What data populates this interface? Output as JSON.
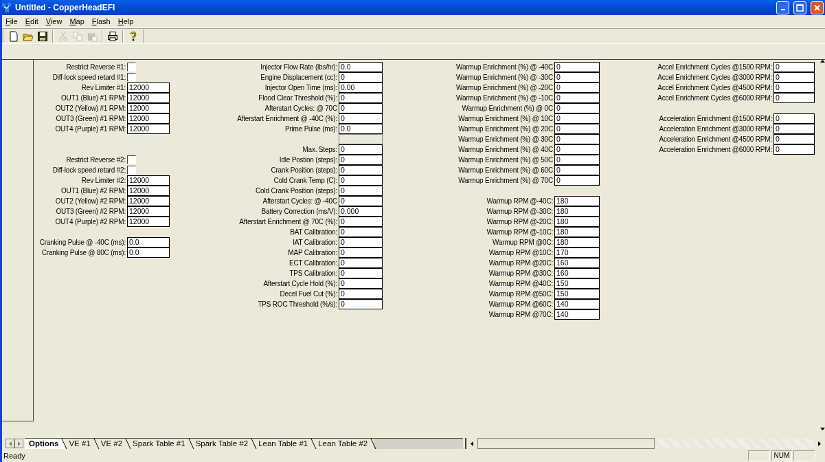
{
  "window": {
    "title": "Untitled - CopperHeadEFI"
  },
  "menu": [
    "File",
    "Edit",
    "View",
    "Map",
    "Flash",
    "Help"
  ],
  "toolbar": [
    {
      "kind": "new",
      "disabled": false
    },
    {
      "kind": "open",
      "disabled": false
    },
    {
      "kind": "save",
      "disabled": false
    },
    {
      "kind": "separator"
    },
    {
      "kind": "cut",
      "disabled": true
    },
    {
      "kind": "copy",
      "disabled": true
    },
    {
      "kind": "paste",
      "disabled": true
    },
    {
      "kind": "separator"
    },
    {
      "kind": "print",
      "disabled": false
    },
    {
      "kind": "separator"
    },
    {
      "kind": "help",
      "disabled": false
    }
  ],
  "form": {
    "columns": [
      {
        "groups": [
          {
            "rows": [
              {
                "kind": "checkbox",
                "label": "Restrict Reverse #1:",
                "checked": false
              },
              {
                "kind": "checkbox",
                "label": "Diff-lock speed retard #1:",
                "checked": false
              },
              {
                "kind": "field",
                "label": "Rev Limiter #1:",
                "value": "12000"
              },
              {
                "kind": "field",
                "label": "OUT1 (Blue) #1 RPM:",
                "value": "12000"
              },
              {
                "kind": "field",
                "label": "OUT2 (Yellow) #1 RPM:",
                "value": "12000"
              },
              {
                "kind": "field",
                "label": "OUT3 (Green) #1 RPM:",
                "value": "12000"
              },
              {
                "kind": "field",
                "label": "OUT4 (Purple) #1 RPM:",
                "value": "12000"
              }
            ]
          },
          {
            "rows": [
              {
                "kind": "checkbox",
                "label": "Restrict Reverse #2:",
                "checked": false
              },
              {
                "kind": "checkbox",
                "label": "Diff-lock speed retard #2:",
                "checked": false
              },
              {
                "kind": "field",
                "label": "Rev Limiter #2:",
                "value": "12000"
              },
              {
                "kind": "field",
                "label": "OUT1 (Blue) #2 RPM:",
                "value": "12000"
              },
              {
                "kind": "field",
                "label": "OUT2 (Yellow) #2 RPM:",
                "value": "12000"
              },
              {
                "kind": "field",
                "label": "OUT3 (Green) #2 RPM:",
                "value": "12000"
              },
              {
                "kind": "field",
                "label": "OUT4 (Purple) #2 RPM:",
                "value": "12000"
              }
            ]
          },
          {
            "rows": [
              {
                "kind": "field",
                "label": "Cranking Pulse @ -40C (ms):",
                "value": "0.0"
              },
              {
                "kind": "field",
                "label": "Cranking Pulse @ 80C (ms):",
                "value": "0.0"
              }
            ]
          }
        ]
      },
      {
        "groups": [
          {
            "rows": [
              {
                "kind": "field",
                "label": "Injector Flow Rate (lbs/hr):",
                "value": "0.0"
              },
              {
                "kind": "field",
                "label": "Engine Displacement (cc):",
                "value": "0"
              },
              {
                "kind": "field",
                "label": "Injector Open Time (ms):",
                "value": "0.00"
              },
              {
                "kind": "field",
                "label": "Flood Clear Threshold (%):",
                "value": "0"
              },
              {
                "kind": "field",
                "label": "Afterstart Cycles: @ 70C",
                "value": "0"
              },
              {
                "kind": "field",
                "label": "Afterstart Enrichment @ -40C (%):",
                "value": "0"
              },
              {
                "kind": "field",
                "label": "Prime Pulse (ms):",
                "value": "0.0"
              },
              {
                "kind": "field",
                "disabled": true
              },
              {
                "kind": "field",
                "label": "Max. Steps:",
                "value": "0"
              },
              {
                "kind": "field",
                "label": "Idle Postion (steps):",
                "value": "0"
              },
              {
                "kind": "field",
                "label": "Crank Position (steps):",
                "value": "0"
              },
              {
                "kind": "field",
                "label": "Cold Crank Temp (C):",
                "value": "0"
              },
              {
                "kind": "field",
                "label": "Cold Crank Position (steps):",
                "value": "0"
              },
              {
                "kind": "field",
                "label": "Afterstart Cycles: @ -40C",
                "value": "0"
              },
              {
                "kind": "field",
                "label": "Battery Correction (ms/V):",
                "value": "0.000"
              },
              {
                "kind": "field",
                "label": "Afterstart Enrichment @ 70C (%):",
                "value": "0"
              },
              {
                "kind": "field",
                "label": "BAT Calibration:",
                "value": "0"
              },
              {
                "kind": "field",
                "label": "IAT Calibration:",
                "value": "0"
              },
              {
                "kind": "field",
                "label": "MAP Calibration:",
                "value": "0"
              },
              {
                "kind": "field",
                "label": "ECT Calibration:",
                "value": "0"
              },
              {
                "kind": "field",
                "label": "TPS Calibration:",
                "value": "0"
              },
              {
                "kind": "field",
                "label": "Afterstart Cycle Hold (%):",
                "value": "0"
              },
              {
                "kind": "field",
                "label": "Decel Fuel Cut (%):",
                "value": "0"
              },
              {
                "kind": "field",
                "label": "TPS ROC Threshold (%/s):",
                "value": "0"
              }
            ]
          }
        ]
      },
      {
        "groups": [
          {
            "rows": [
              {
                "kind": "field",
                "label": "Warmup Enrichment (%) @ -40C",
                "value": "0"
              },
              {
                "kind": "field",
                "label": "Warmup Enrichment (%) @ -30C",
                "value": "0"
              },
              {
                "kind": "field",
                "label": "Warmup Enrichment (%) @ -20C",
                "value": "0"
              },
              {
                "kind": "field",
                "label": "Warmup Enrichment (%) @ -10C",
                "value": "0"
              },
              {
                "kind": "field",
                "label": "Warmup Enrichment (%) @  0C",
                "value": "0"
              },
              {
                "kind": "field",
                "label": "Warmup Enrichment (%) @ 10C",
                "value": "0"
              },
              {
                "kind": "field",
                "label": "Warmup Enrichment (%) @ 20C",
                "value": "0"
              },
              {
                "kind": "field",
                "label": "Warmup Enrichment (%) @ 30C",
                "value": "0"
              },
              {
                "kind": "field",
                "label": "Warmup Enrichment (%) @ 40C",
                "value": "0"
              },
              {
                "kind": "field",
                "label": "Warmup Enrichment (%) @ 50C",
                "value": "0"
              },
              {
                "kind": "field",
                "label": "Warmup Enrichment (%) @ 60C",
                "value": "0"
              },
              {
                "kind": "field",
                "label": "Warmup Enrichment (%) @ 70C",
                "value": "0"
              }
            ]
          },
          {
            "rows": [
              {
                "kind": "field",
                "label": "Warmup RPM @-40C:",
                "value": "180"
              },
              {
                "kind": "field",
                "label": "Warmup RPM @-30C:",
                "value": "180"
              },
              {
                "kind": "field",
                "label": "Warmup RPM @-20C:",
                "value": "180"
              },
              {
                "kind": "field",
                "label": "Warmup RPM @-10C:",
                "value": "180"
              },
              {
                "kind": "field",
                "label": "Warmup RPM @0C:",
                "value": "180"
              },
              {
                "kind": "field",
                "label": "Warmup RPM @10C:",
                "value": "170"
              },
              {
                "kind": "field",
                "label": "Warmup RPM @20C:",
                "value": "160"
              },
              {
                "kind": "field",
                "label": "Warmup RPM @30C:",
                "value": "160"
              },
              {
                "kind": "field",
                "label": "Warmup RPM @40C:",
                "value": "150"
              },
              {
                "kind": "field",
                "label": "Warmup RPM @50C:",
                "value": "150"
              },
              {
                "kind": "field",
                "label": "Warmup RPM @60C:",
                "value": "140"
              },
              {
                "kind": "field",
                "label": "Warmup RPM @70C:",
                "value": "140"
              }
            ]
          }
        ]
      },
      {
        "groups": [
          {
            "rows": [
              {
                "kind": "field",
                "label": "Accel Enrichment Cycles @1500 RPM:",
                "value": "0"
              },
              {
                "kind": "field",
                "label": "Accel Enrichment Cycles @3000 RPM:",
                "value": "0"
              },
              {
                "kind": "field",
                "label": "Accel Enrichment Cycles @4500 RPM:",
                "value": "0"
              },
              {
                "kind": "field",
                "label": "Accel Enrichment Cycles @6000 RPM:",
                "value": "0"
              }
            ]
          },
          {
            "rows": [
              {
                "kind": "field",
                "label": "Acceleration Enrichment @1500 RPM:",
                "value": "0"
              },
              {
                "kind": "field",
                "label": "Acceleration Enrichment @3000 RPM:",
                "value": "0"
              },
              {
                "kind": "field",
                "label": "Acceleration Enrichment @4500 RPM:",
                "value": "0"
              },
              {
                "kind": "field",
                "label": "Acceleration Enrichment @6000 RPM:",
                "value": "0"
              }
            ]
          }
        ]
      }
    ]
  },
  "sheet_tabs": [
    {
      "label": "Options",
      "selected": true
    },
    {
      "label": "VE #1",
      "selected": false
    },
    {
      "label": "VE #2",
      "selected": false
    },
    {
      "label": "Spark Table #1",
      "selected": false
    },
    {
      "label": "Spark Table #2",
      "selected": false
    },
    {
      "label": "Lean Table #1",
      "selected": false
    },
    {
      "label": "Lean Table #2",
      "selected": false
    }
  ],
  "status_bar": {
    "text": "Ready",
    "indicators": [
      {
        "kind": "blank"
      },
      {
        "kind": "text",
        "text": "NUM"
      },
      {
        "kind": "blank"
      }
    ]
  }
}
